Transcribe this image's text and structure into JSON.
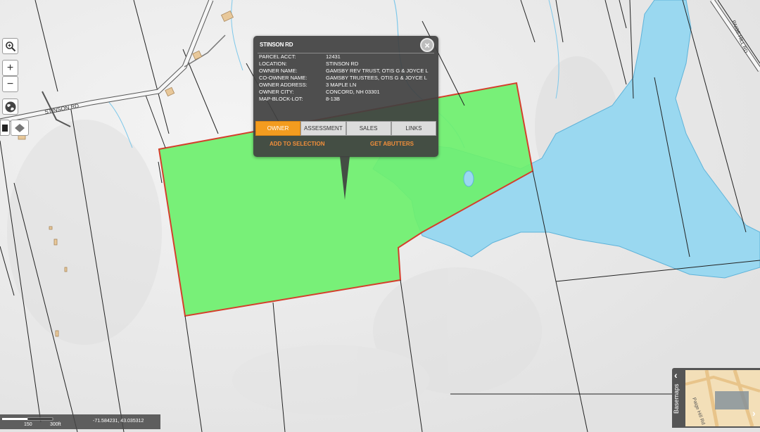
{
  "map": {
    "road_labels": {
      "stinson": "STINSON RD",
      "paige_hill": "PAIGE HILL RD"
    },
    "colors": {
      "parcel_fill": "#6ef06e",
      "parcel_stroke": "#d43f2c",
      "water": "#9ad8f0",
      "terrain": "#ececec"
    }
  },
  "popup": {
    "title": "STINSON RD",
    "close_icon": "close-icon",
    "fields": [
      {
        "label": "PARCEL ACCT:",
        "value": "12431"
      },
      {
        "label": "LOCATION:",
        "value": "STINSON RD"
      },
      {
        "label": "OWNER NAME:",
        "value": "GAMSBY REV TRUST, OTIS G & JOYCE L"
      },
      {
        "label": "CO-OWNER NAME:",
        "value": "GAMSBY TRUSTEES, OTIS G & JOYCE L"
      },
      {
        "label": "OWNER ADDRESS:",
        "value": "3 MAPLE LN"
      },
      {
        "label": "OWNER CITY:",
        "value": "CONCORD, NH 03301"
      },
      {
        "label": "MAP-BLOCK-LOT:",
        "value": "8-13B"
      }
    ],
    "tabs": [
      "OWNER",
      "ASSESSMENT",
      "SALES",
      "LINKS"
    ],
    "active_tab": "OWNER",
    "add_to_selection": "ADD TO SELECTION",
    "get_abutters": "GET ABUTTERS"
  },
  "controls": {
    "zoom_in": "+",
    "zoom_out": "−"
  },
  "status": {
    "coords": "-71.584231, 43.035312",
    "scale_mid": "150",
    "scale_end": "300ft"
  },
  "basemaps": {
    "label": "Basemaps",
    "thumb_label": "Paige Hill Rd"
  }
}
